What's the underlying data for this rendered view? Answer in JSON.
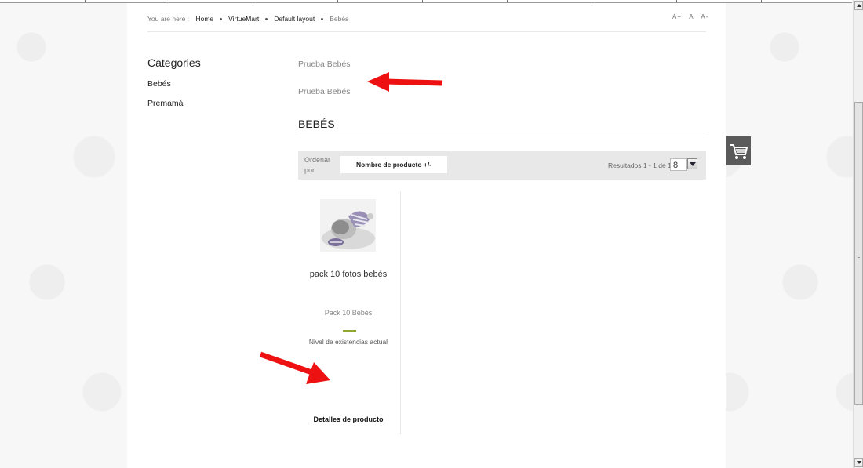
{
  "breadcrumb": {
    "prefix": "You are here :",
    "items": [
      "Home",
      "VirtueMart",
      "Default layout",
      "Bebés"
    ]
  },
  "font_size_controls": [
    "A+",
    "A",
    "A-"
  ],
  "sidebar": {
    "title": "Categories",
    "items": [
      "Bebés",
      "Premamá"
    ]
  },
  "subcategories": [
    "Prueba Bebés",
    "Prueba Bebés"
  ],
  "category_heading": "BEBÉS",
  "toolbar": {
    "order_label": "Ordenar por",
    "order_button": "Nombre de producto +/-",
    "results_text": "Resultados 1 - 1 de 1",
    "per_page": "8"
  },
  "product": {
    "name": "pack 10 fotos bebés",
    "short_desc": "Pack 10 Bebés",
    "stock_label": "Nivel de existencias actual",
    "stock_level": 0.6,
    "details_link": "Detalles de producto"
  },
  "colors": {
    "stock_bar": "#8faa2e",
    "annotation_arrow": "#ee1111",
    "cart_button": "#5a5a5a"
  },
  "icons": [
    "cart-icon",
    "scroll-up-icon",
    "scroll-down-icon"
  ]
}
